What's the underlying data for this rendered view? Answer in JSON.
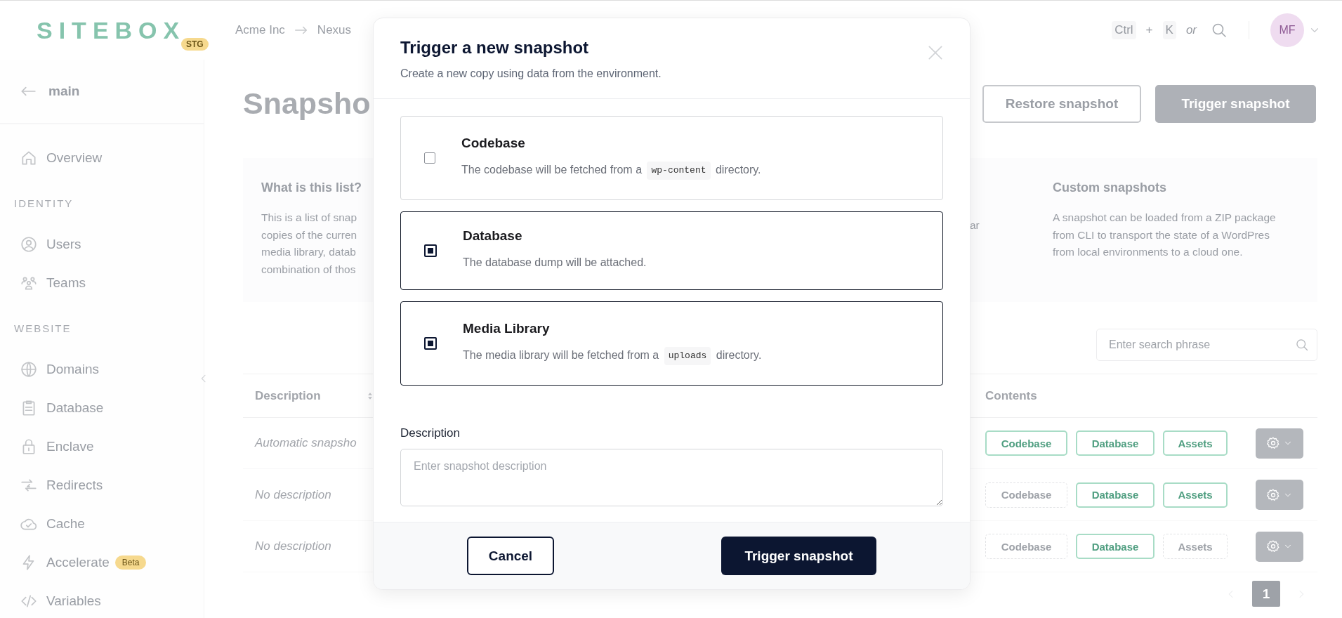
{
  "top_bar": {
    "logo": "SITEBOX",
    "logo_badge": "STG",
    "breadcrumbs": [
      "Acme Inc",
      "Nexus"
    ],
    "shortcut": {
      "keys": [
        "Ctrl",
        "K"
      ],
      "joiner": "+",
      "alt": "or"
    },
    "avatar": "MF"
  },
  "sidebar": {
    "back": "main",
    "items": [
      {
        "kind": "link",
        "label": "Overview"
      },
      {
        "kind": "heading",
        "label": "IDENTITY"
      },
      {
        "kind": "link",
        "label": "Users"
      },
      {
        "kind": "link",
        "label": "Teams"
      },
      {
        "kind": "heading",
        "label": "WEBSITE"
      },
      {
        "kind": "link",
        "label": "Domains"
      },
      {
        "kind": "link",
        "label": "Database"
      },
      {
        "kind": "link",
        "label": "Enclave"
      },
      {
        "kind": "link",
        "label": "Redirects"
      },
      {
        "kind": "link",
        "label": "Cache"
      },
      {
        "kind": "link",
        "label": "Accelerate",
        "badge": "Beta"
      },
      {
        "kind": "link",
        "label": "Variables"
      }
    ]
  },
  "page": {
    "title": "Snapsho",
    "buttons": [
      {
        "label": "Restore snapshot",
        "kind": "outline"
      },
      {
        "label": "Trigger snapshot",
        "kind": "primary"
      }
    ],
    "info_cards": [
      {
        "title": "What is this list?",
        "lines": [
          "This is a list of snap",
          "copies of the curren",
          "media library, datab",
          "combination of thos"
        ]
      },
      {
        "lines": [
          "ar"
        ]
      },
      {
        "title": "Custom snapshots",
        "lines": [
          "A snapshot can be loaded from a ZIP package",
          "from CLI to transport the state of a WordPres",
          "from local environments to a cloud one."
        ]
      }
    ],
    "search": {
      "placeholder": "Enter search phrase"
    },
    "table": {
      "columns": [
        "Description",
        "Contents"
      ],
      "rows": [
        {
          "description": "Automatic snapsho",
          "contents": [
            {
              "label": "Codebase",
              "included": true
            },
            {
              "label": "Database",
              "included": true
            },
            {
              "label": "Assets",
              "included": true
            }
          ]
        },
        {
          "description": "No description",
          "contents": [
            {
              "label": "Codebase",
              "included": false
            },
            {
              "label": "Database",
              "included": true
            },
            {
              "label": "Assets",
              "included": true
            }
          ]
        },
        {
          "description": "No description",
          "contents": [
            {
              "label": "Codebase",
              "included": false
            },
            {
              "label": "Database",
              "included": true
            },
            {
              "label": "Assets",
              "included": false
            }
          ]
        }
      ]
    },
    "pagination": [
      {
        "label": "1",
        "selected": true
      }
    ]
  },
  "modal": {
    "title": "Trigger a new snapshot",
    "subtitle": "Create a new copy using data from the environment.",
    "options": [
      {
        "title": "Codebase",
        "checked": false,
        "description": [
          {
            "text": "The codebase will be fetched from a "
          },
          {
            "code": "wp-content"
          },
          {
            "text": " directory."
          }
        ]
      },
      {
        "title": "Database",
        "checked": true,
        "description": [
          {
            "text": "The database dump will be attached."
          }
        ]
      },
      {
        "title": "Media Library",
        "checked": true,
        "description": [
          {
            "text": "The media library will be fetched from a "
          },
          {
            "code": "uploads"
          },
          {
            "text": " directory."
          }
        ]
      }
    ],
    "description_field": {
      "label": "Description",
      "placeholder": "Enter snapshot description"
    },
    "buttons": [
      {
        "label": "Cancel",
        "kind": "secondary"
      },
      {
        "label": "Trigger snapshot",
        "kind": "primary"
      }
    ]
  }
}
